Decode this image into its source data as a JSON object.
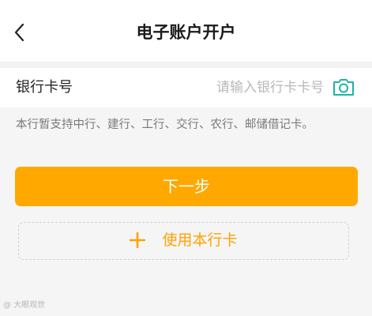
{
  "header": {
    "title": "电子账户开户",
    "back_icon": "chevron-left-icon"
  },
  "card_number": {
    "label": "银行卡号",
    "value": "",
    "placeholder": "请输入银行卡卡号",
    "camera_icon": "camera-icon"
  },
  "notice": "本行暂支持中行、建行、工行、交行、农行、邮储借记卡。",
  "actions": {
    "next_label": "下一步",
    "use_card_label": "使用本行卡",
    "use_card_icon": "plus-icon"
  },
  "colors": {
    "accent": "#FFA800",
    "camera": "#1DB3A6",
    "background": "#F5F5F5"
  },
  "watermark": "@ 大眼观世"
}
